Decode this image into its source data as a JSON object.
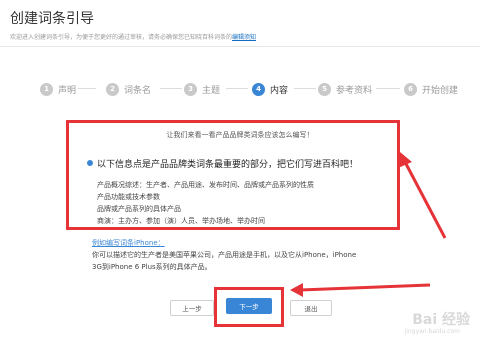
{
  "page": {
    "title": "创建词条引导",
    "subtitle_text": "欢迎进入创建词条引导，为便于您更好的通过审核，请务必确保您已知晓百科词条的",
    "subtitle_link": "编辑须知"
  },
  "steps": [
    {
      "num": "1",
      "label": "声明"
    },
    {
      "num": "2",
      "label": "词条名"
    },
    {
      "num": "3",
      "label": "主题"
    },
    {
      "num": "4",
      "label": "内容"
    },
    {
      "num": "5",
      "label": "参考资料"
    },
    {
      "num": "6",
      "label": "开始创建"
    }
  ],
  "content": {
    "intro": "让我们来看一看产品品牌类词条应该怎么编写！",
    "headline": "以下信息点是产品品牌类词条最重要的部分，把它们写进百科吧！",
    "details": [
      "产品概况综述：生产者、产品用途、发布时间、品牌或产品系列的性质",
      "产品功能或技术参数",
      "品牌或产品系列的具体产品",
      "商演：主办方、参加（演）人员、举办场地、举办时间"
    ]
  },
  "example": {
    "title": "例如编写词条iPhone：",
    "lines": [
      "你可以描述它的生产者是美国苹果公司，产品用途是手机，以及它从iPhone，iPhone",
      "3G到iPhone 6 Plus系列的具体产品。"
    ]
  },
  "buttons": {
    "prev": "上一步",
    "next": "下一步",
    "exit": "退出"
  },
  "watermark": {
    "text": "Bai 经验",
    "sub": "jingyan.baidu.com"
  },
  "colors": {
    "accent": "#3a86d6",
    "annotation_red": "#e53338"
  }
}
